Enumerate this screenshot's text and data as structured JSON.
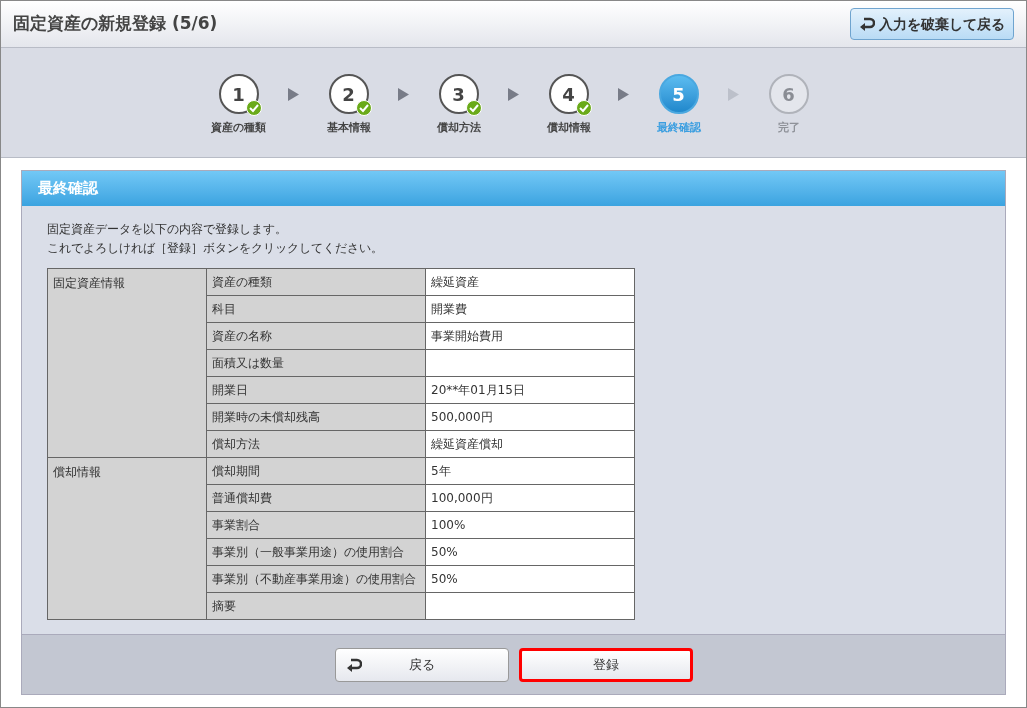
{
  "window": {
    "title": "固定資産の新規登録 (5/6)",
    "discard_button": "入力を破棄して戻る"
  },
  "steps": [
    {
      "number": "1",
      "label": "資産の種類",
      "completed": true,
      "selected": false
    },
    {
      "number": "2",
      "label": "基本情報",
      "completed": true,
      "selected": false
    },
    {
      "number": "3",
      "label": "償却方法",
      "completed": true,
      "selected": false
    },
    {
      "number": "4",
      "label": "償却情報",
      "completed": true,
      "selected": false
    },
    {
      "number": "5",
      "label": "最終確認",
      "completed": false,
      "selected": true
    },
    {
      "number": "6",
      "label": "完了",
      "completed": false,
      "selected": false
    }
  ],
  "panel": {
    "title": "最終確認",
    "message": [
      "固定資産データを以下の内容で登録します。",
      "これでよろしければ［登録］ボタンをクリックしてください。"
    ]
  },
  "table": {
    "groups": [
      {
        "label": "固定資産情報",
        "rows": [
          {
            "item": "資産の種類",
            "value": "繰延資産"
          },
          {
            "item": "科目",
            "value": "開業費"
          },
          {
            "item": "資産の名称",
            "value": "事業開始費用"
          },
          {
            "item": "面積又は数量",
            "value": ""
          },
          {
            "item": "開業日",
            "value": "20**年01月15日"
          },
          {
            "item": "開業時の未償却残高",
            "value": "500,000円"
          },
          {
            "item": "償却方法",
            "value": "繰延資産償却"
          }
        ]
      },
      {
        "label": "償却情報",
        "rows": [
          {
            "item": "償却期間",
            "value": "5年"
          },
          {
            "item": "普通償却費",
            "value": "100,000円"
          },
          {
            "item": "事業割合",
            "value": "100%"
          },
          {
            "item": "事業別（一般事業用途）の使用割合",
            "value": "50%"
          },
          {
            "item": "事業別（不動産事業用途）の使用割合",
            "value": "50%"
          },
          {
            "item": "摘要",
            "value": ""
          }
        ]
      }
    ]
  },
  "buttons": [
    {
      "label": "戻る",
      "kind": "back",
      "highlighted": false
    },
    {
      "label": "登録",
      "kind": "submit",
      "highlighted": true
    }
  ]
}
